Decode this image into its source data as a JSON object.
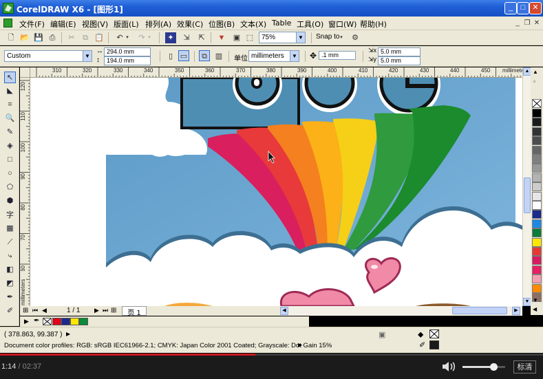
{
  "window": {
    "title": "CorelDRAW X6 - [图形1]",
    "controls": {
      "minimize": "_",
      "maximize": "□",
      "close": "✕"
    }
  },
  "menubar": {
    "items": [
      "文件(F)",
      "编辑(E)",
      "视图(V)",
      "版面(L)",
      "排列(A)",
      "效果(C)",
      "位图(B)",
      "文本(X)",
      "Table",
      "工具(O)",
      "窗口(W)",
      "帮助(H)"
    ],
    "mdi_controls": {
      "minimize": "_",
      "restore": "❐",
      "close": "✕"
    }
  },
  "toolbar": {
    "zoom_value": "75%",
    "snap_to_label": "Snap to",
    "icons": [
      "new-icon",
      "open-icon",
      "save-icon",
      "print-icon",
      "cut-icon",
      "copy-icon",
      "paste-icon",
      "undo-icon",
      "redo-icon",
      "import-icon",
      "export-icon",
      "publish-icon",
      "app-launcher-icon",
      "snap-icon",
      "options-icon"
    ]
  },
  "propertybar": {
    "page_size": "Custom",
    "width": "294.0 mm",
    "height": "194.0 mm",
    "units_label": "单位:",
    "units_value": "millimeters",
    "nudge": ".1 mm",
    "dup_x": "5.0 mm",
    "dup_y": "5.0 mm"
  },
  "rulers": {
    "horizontal_ticks": [
      "310",
      "320",
      "330",
      "340",
      "350",
      "360",
      "370",
      "380",
      "390",
      "400",
      "410",
      "420",
      "430",
      "440",
      "450"
    ],
    "horizontal_unit": "millimeters",
    "vertical_ticks": [
      "120",
      "110",
      "100",
      "90",
      "80",
      "70",
      "60",
      "50"
    ],
    "vertical_unit": "millimeters"
  },
  "pagenav": {
    "page_count": "1 / 1",
    "page_tab": "页 1"
  },
  "palette_colors": [
    "#000000",
    "#1a1a1a",
    "#333333",
    "#4d4d4d",
    "#666666",
    "#808080",
    "#999999",
    "#b3b3b3",
    "#cccccc",
    "#e6e6e6",
    "#ffffff",
    "#1b2a8c",
    "#1e88e5",
    "#0a7d3a",
    "#ffe600",
    "#e53935",
    "#d81b60",
    "#e91e63",
    "#f4a0b0",
    "#ff8a00",
    "#8d6e63"
  ],
  "document_palette": [
    "#e2001a",
    "#1b2a8c",
    "#ffe600",
    "#0a8a3a"
  ],
  "status": {
    "coordinates": "( 378.863, 99.387 )",
    "color_profiles": "Document color profiles: RGB: sRGB IEC61966-2.1; CMYK: Japan Color 2001 Coated; Grayscale: Dot Gain 15%"
  },
  "player": {
    "current_time": "1:14",
    "total_time": "02:37",
    "progress": 0.47,
    "volume": 0.72,
    "quality_label": "标清"
  }
}
